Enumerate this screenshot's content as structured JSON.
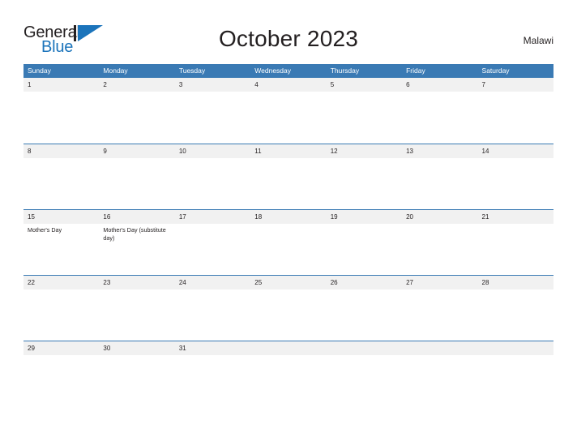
{
  "brand": {
    "name_part1": "General",
    "name_part2": "Blue",
    "logo_icon": "flag-triangle-icon"
  },
  "header": {
    "title": "October 2023",
    "country": "Malawi"
  },
  "colors": {
    "header_blue": "#3a7ab4",
    "brand_blue": "#1b74bb",
    "day_band_gray": "#f1f1f1",
    "text_dark": "#231f20"
  },
  "calendar": {
    "weekdays": [
      "Sunday",
      "Monday",
      "Tuesday",
      "Wednesday",
      "Thursday",
      "Friday",
      "Saturday"
    ],
    "weeks": [
      [
        {
          "date": "1",
          "events": []
        },
        {
          "date": "2",
          "events": []
        },
        {
          "date": "3",
          "events": []
        },
        {
          "date": "4",
          "events": []
        },
        {
          "date": "5",
          "events": []
        },
        {
          "date": "6",
          "events": []
        },
        {
          "date": "7",
          "events": []
        }
      ],
      [
        {
          "date": "8",
          "events": []
        },
        {
          "date": "9",
          "events": []
        },
        {
          "date": "10",
          "events": []
        },
        {
          "date": "11",
          "events": []
        },
        {
          "date": "12",
          "events": []
        },
        {
          "date": "13",
          "events": []
        },
        {
          "date": "14",
          "events": []
        }
      ],
      [
        {
          "date": "15",
          "events": [
            "Mother's Day"
          ]
        },
        {
          "date": "16",
          "events": [
            "Mother's Day (substitute day)"
          ]
        },
        {
          "date": "17",
          "events": []
        },
        {
          "date": "18",
          "events": []
        },
        {
          "date": "19",
          "events": []
        },
        {
          "date": "20",
          "events": []
        },
        {
          "date": "21",
          "events": []
        }
      ],
      [
        {
          "date": "22",
          "events": []
        },
        {
          "date": "23",
          "events": []
        },
        {
          "date": "24",
          "events": []
        },
        {
          "date": "25",
          "events": []
        },
        {
          "date": "26",
          "events": []
        },
        {
          "date": "27",
          "events": []
        },
        {
          "date": "28",
          "events": []
        }
      ],
      [
        {
          "date": "29",
          "events": []
        },
        {
          "date": "30",
          "events": []
        },
        {
          "date": "31",
          "events": []
        },
        {
          "date": "",
          "events": []
        },
        {
          "date": "",
          "events": []
        },
        {
          "date": "",
          "events": []
        },
        {
          "date": "",
          "events": []
        }
      ]
    ]
  }
}
